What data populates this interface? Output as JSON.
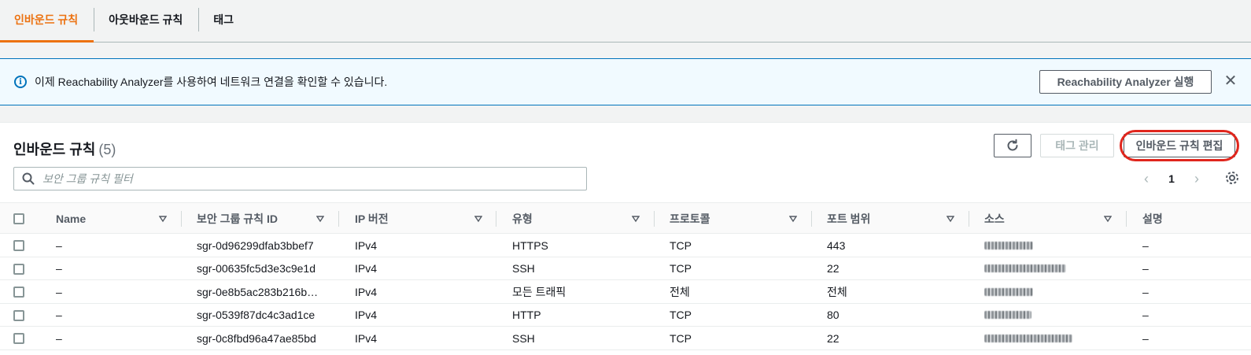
{
  "tabs": [
    {
      "label": "인바운드 규칙",
      "active": true
    },
    {
      "label": "아웃바운드 규칙",
      "active": false
    },
    {
      "label": "태그",
      "active": false
    }
  ],
  "banner": {
    "text": "이제 Reachability Analyzer를 사용하여 네트워크 연결을 확인할 수 있습니다.",
    "button_label": "Reachability Analyzer 실행"
  },
  "panel": {
    "title": "인바운드 규칙",
    "count": "(5)",
    "manage_tags_label": "태그 관리",
    "edit_label": "인바운드 규칙 편집",
    "filter_placeholder": "보안 그룹 규칙 필터",
    "page": "1"
  },
  "table": {
    "columns": [
      "Name",
      "보안 그룹 규칙 ID",
      "IP 버전",
      "유형",
      "프로토콜",
      "포트 범위",
      "소스",
      "설명"
    ],
    "rows": [
      {
        "name": "–",
        "id": "sgr-0d96299dfab3bbef7",
        "ip": "IPv4",
        "type": "HTTPS",
        "protocol": "TCP",
        "port": "443",
        "desc": "–"
      },
      {
        "name": "–",
        "id": "sgr-00635fc5d3e3c9e1d",
        "ip": "IPv4",
        "type": "SSH",
        "protocol": "TCP",
        "port": "22",
        "desc": "–"
      },
      {
        "name": "–",
        "id": "sgr-0e8b5ac283b216b…",
        "ip": "IPv4",
        "type": "모든 트래픽",
        "protocol": "전체",
        "port": "전체",
        "desc": "–"
      },
      {
        "name": "–",
        "id": "sgr-0539f87dc4c3ad1ce",
        "ip": "IPv4",
        "type": "HTTP",
        "protocol": "TCP",
        "port": "80",
        "desc": "–"
      },
      {
        "name": "–",
        "id": "sgr-0c8fbd96a47ae85bd",
        "ip": "IPv4",
        "type": "SSH",
        "protocol": "TCP",
        "port": "22",
        "desc": "–"
      }
    ]
  },
  "colors": {
    "accent": "#ec7211",
    "info": "#0073bb",
    "highlight": "#e0261d"
  }
}
